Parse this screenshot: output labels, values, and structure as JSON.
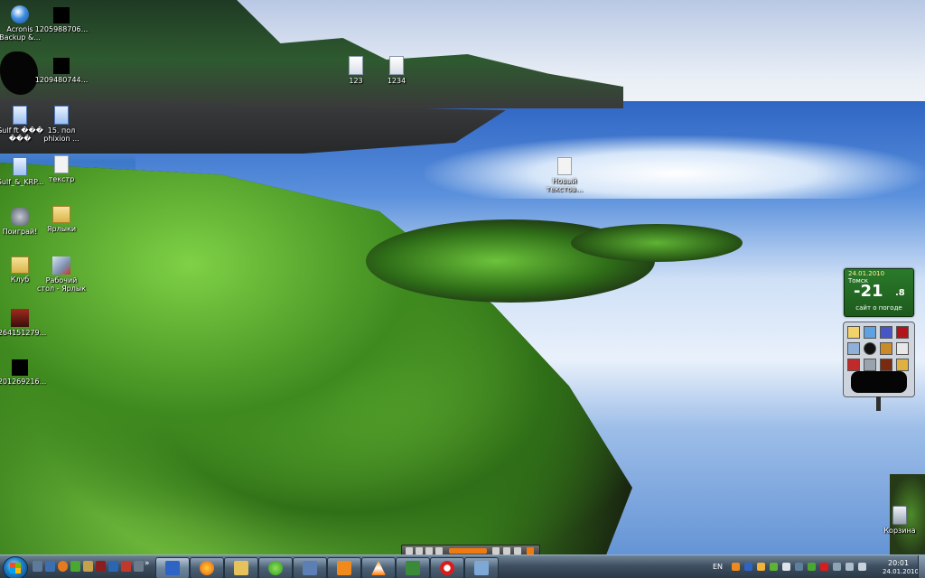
{
  "desktop": {
    "icons": [
      {
        "label": "Acronis\nBackup &...",
        "kind": "acronis"
      },
      {
        "label": "1205988706...",
        "kind": "black"
      },
      {
        "label": "1209480744...",
        "kind": "black"
      },
      {
        "label": "Gulf ft ���\n���",
        "kind": "doc"
      },
      {
        "label": "15. пол\nphixion ...",
        "kind": "doc"
      },
      {
        "label": "Gulf_&_KRP...",
        "kind": "doc"
      },
      {
        "label": "текстр",
        "kind": "text"
      },
      {
        "label": "Поиграй!",
        "kind": "game"
      },
      {
        "label": "Ярлыки",
        "kind": "folder"
      },
      {
        "label": "Клуб",
        "kind": "folder"
      },
      {
        "label": "Рабочий\nстол - Ярлык",
        "kind": "shortcut"
      },
      {
        "label": "1264151279...",
        "kind": "video"
      },
      {
        "label": "1201269216...",
        "kind": "black"
      },
      {
        "label": "123",
        "kind": "file"
      },
      {
        "label": "1234",
        "kind": "file"
      },
      {
        "label": "Новый\nтекстов...",
        "kind": "text"
      },
      {
        "label": "Корзина",
        "kind": "trash"
      }
    ]
  },
  "weather_gadget": {
    "date": "24.01.2010",
    "city": "Томск",
    "temperature": "-21",
    "temperature_decimal": ".8",
    "site_link": "сайт о погоде"
  },
  "taskbar": {
    "start_icon": "windows-orb-icon",
    "quick_launch_icons": [
      "show-desktop-icon",
      "switch-windows-icon",
      "firefox-icon",
      "icq-icon",
      "folder-icon",
      "media-icon",
      "chevron-icon"
    ],
    "task_buttons": [
      "floppy-icon",
      "firefox-icon",
      "explorer-icon",
      "icq-icon",
      "computer-icon",
      "media-player-icon",
      "vlc-icon",
      "image-icon",
      "opera-icon",
      "download-icon"
    ],
    "tray": {
      "language": "EN",
      "time": "20:01",
      "date": "24.01.2010"
    }
  },
  "colors": {
    "taskbar": "#3e4f60",
    "weather_bg": "#2a7a2a",
    "media_volume": "#f07a10"
  }
}
